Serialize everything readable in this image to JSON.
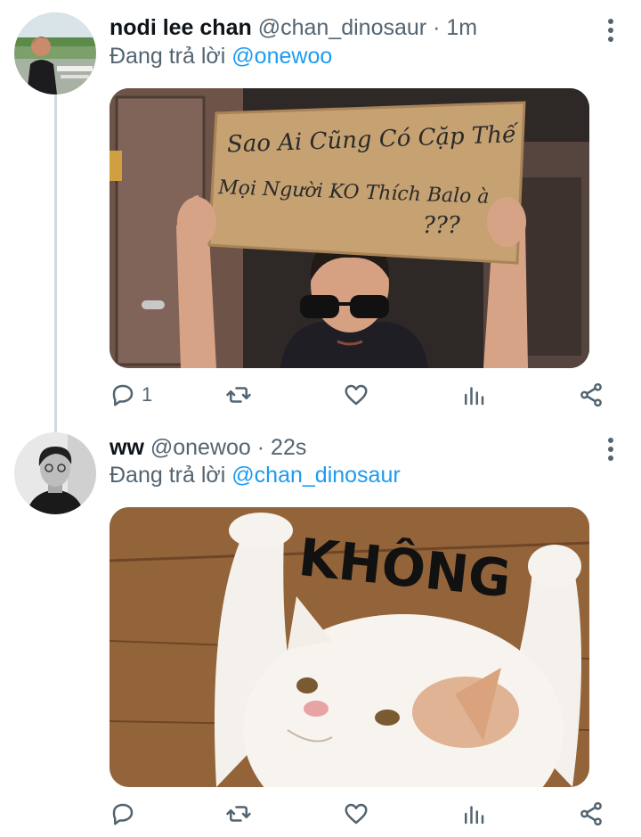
{
  "tweets": [
    {
      "name": "nodi lee chan",
      "handle": "@chan_dinosaur",
      "separator": "·",
      "time": "1m",
      "reply_prefix": "Đang trả lời",
      "reply_mention": "@onewoo",
      "image_text": {
        "line1": "Sao Ai Cũng Có Cặp Thế",
        "line2": "Mọi Người KO Thích Balo à",
        "line3": "???"
      },
      "actions": {
        "reply_count": "1",
        "retweet_count": "",
        "like_count": ""
      }
    },
    {
      "name": "ww",
      "handle": "@onewoo",
      "separator": "·",
      "time": "22s",
      "reply_prefix": "Đang trả lời",
      "reply_mention": "@chan_dinosaur",
      "image_text": {
        "line1": "KHÔNG"
      },
      "actions": {
        "reply_count": "",
        "retweet_count": "",
        "like_count": ""
      }
    }
  ],
  "colors": {
    "accent": "#1d9bf0",
    "secondary_text": "#536471",
    "primary_text": "#0f1419",
    "thread_line": "#cfd9de"
  },
  "icons": [
    "reply-icon",
    "retweet-icon",
    "like-icon",
    "analytics-icon",
    "share-icon",
    "more-icon"
  ]
}
